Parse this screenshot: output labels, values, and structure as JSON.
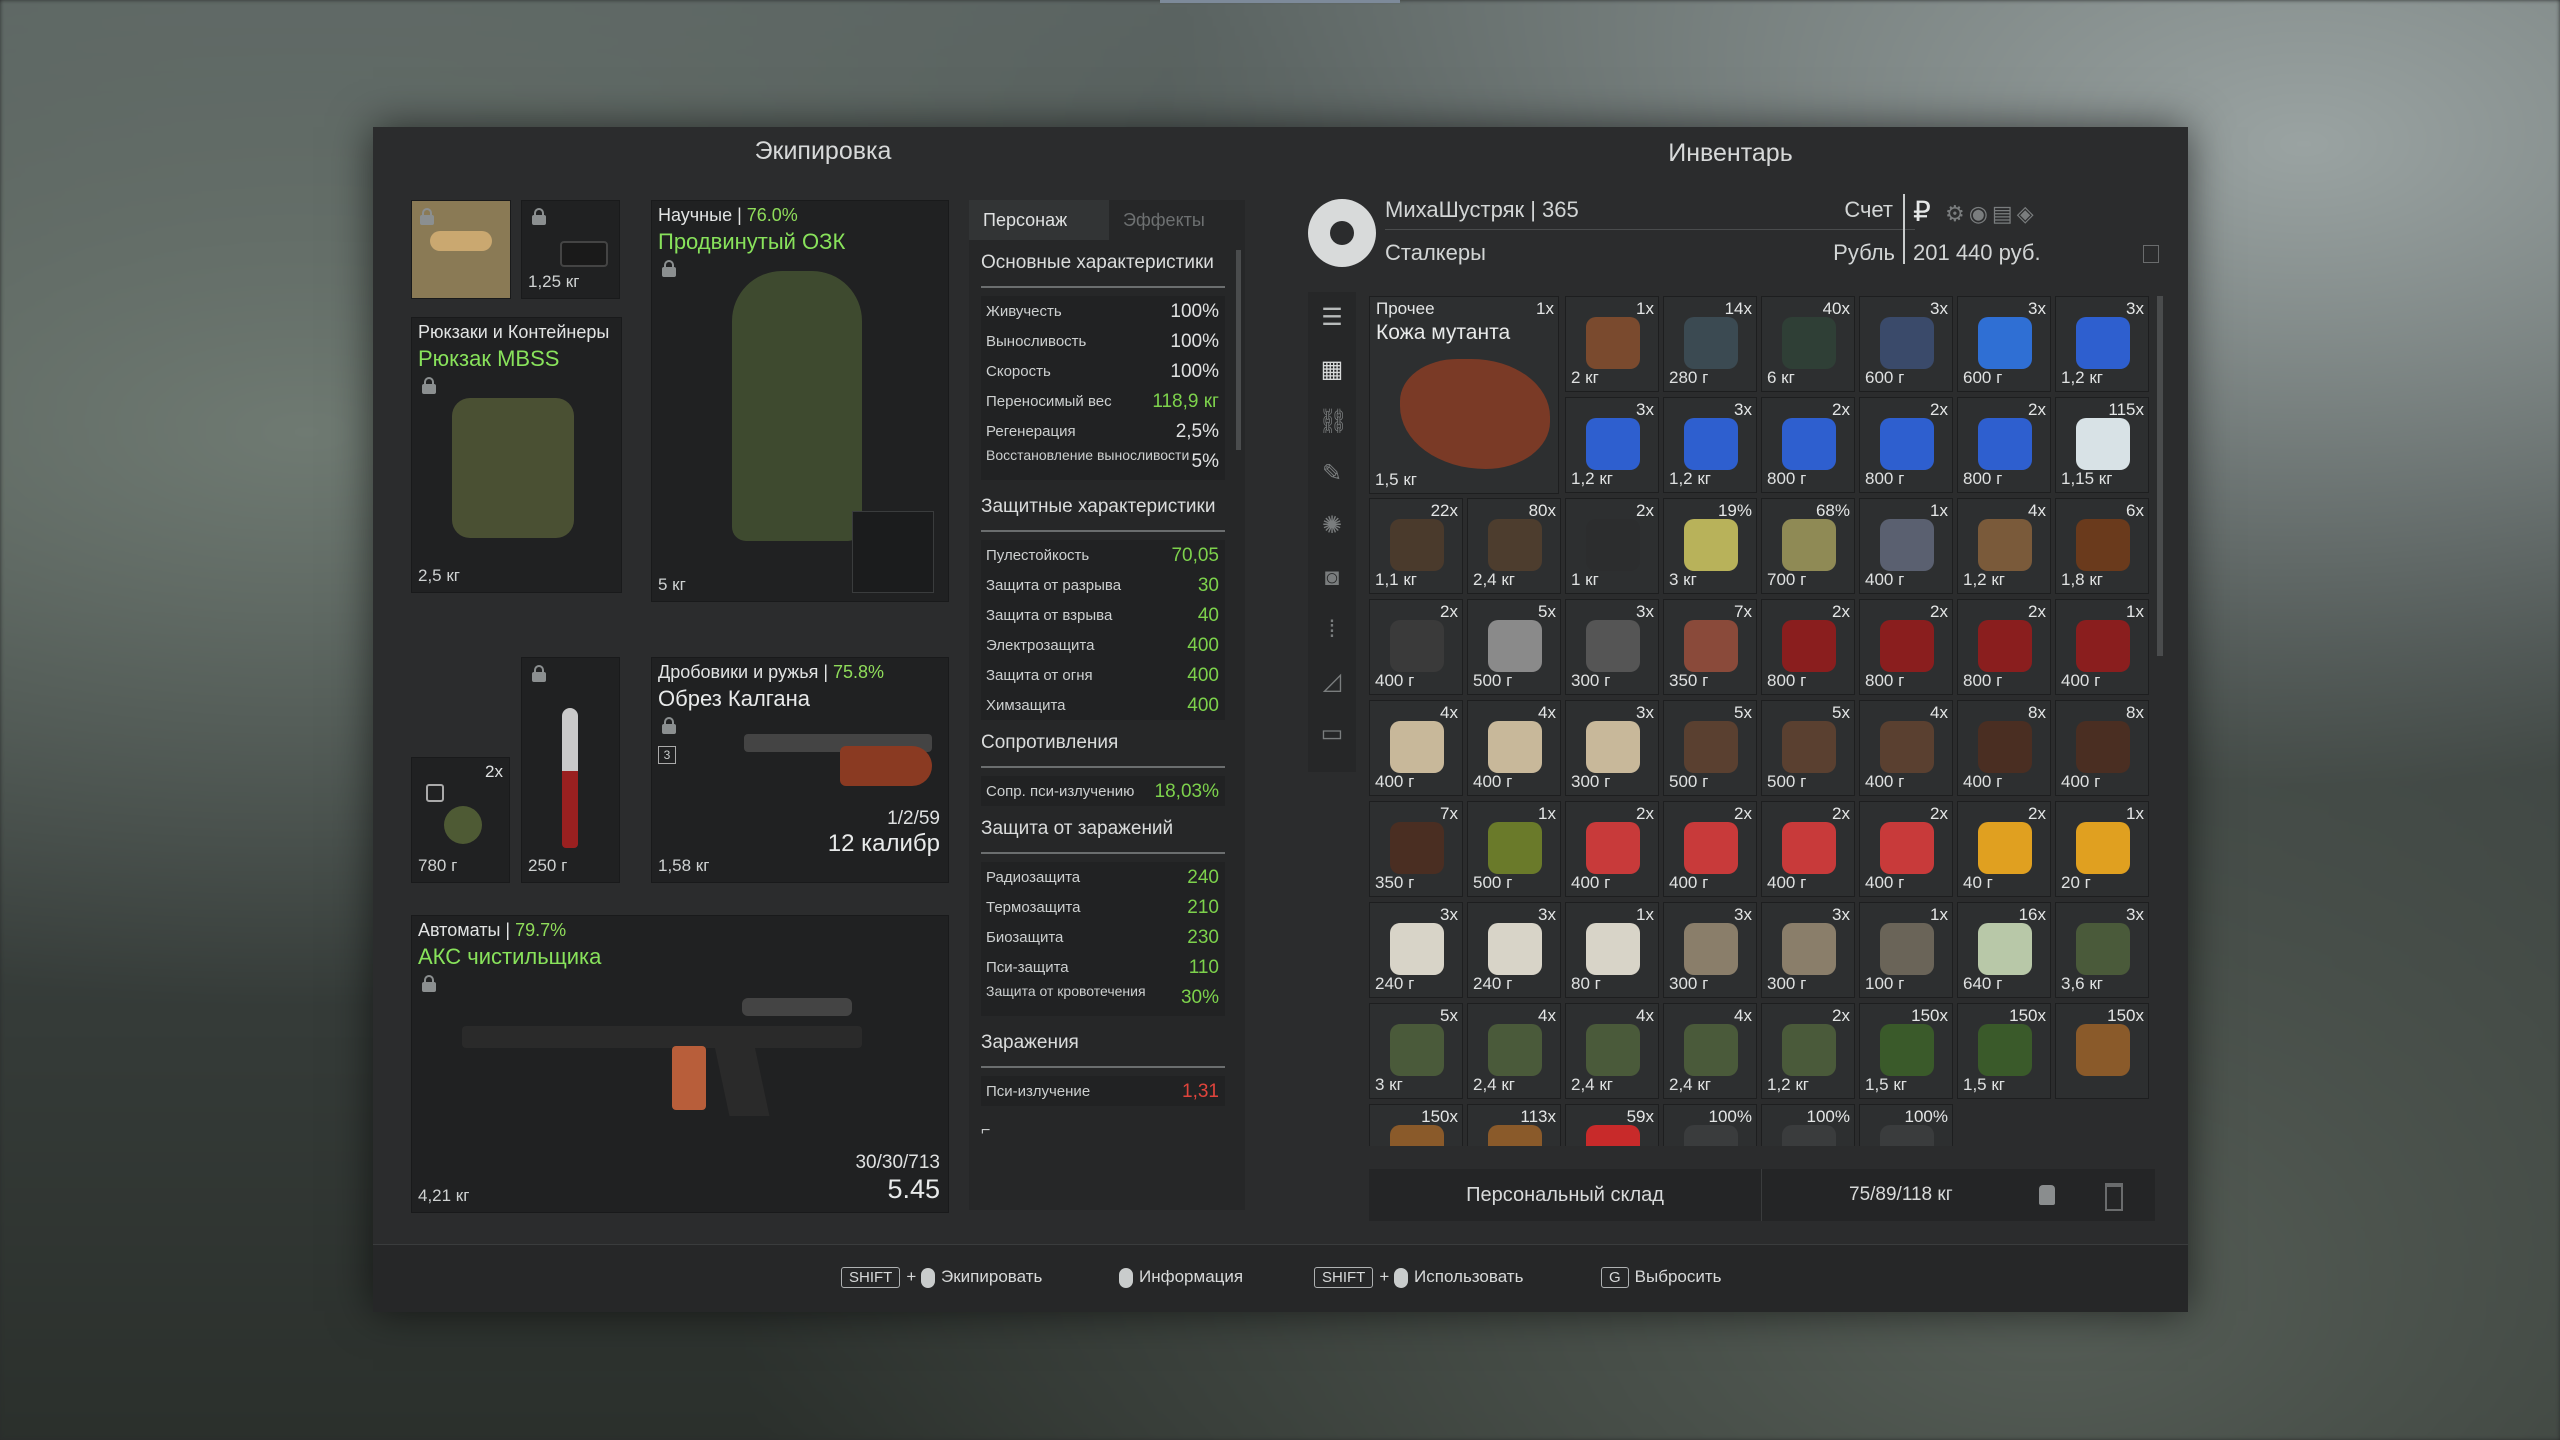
{
  "equipment": {
    "title": "Экипировка",
    "mask_slot": {
      "weight": ""
    },
    "device_slot": {
      "weight": "1,25 кг"
    },
    "backpack": {
      "category": "Рюкзаки и Контейнеры",
      "name": "Рюкзак MBSS",
      "weight": "2,5 кг"
    },
    "suit": {
      "category": "Научные",
      "durability": "76.0%",
      "name": "Продвинутый ОЗК",
      "weight": "5 кг"
    },
    "grenade": {
      "count": "2x",
      "weight": "780 г"
    },
    "knife": {
      "weight": "250 г"
    },
    "shotgun": {
      "category": "Дробовики и ружья",
      "durability": "75.8%",
      "name": "Обрез Калгана",
      "weight": "1,58 кг",
      "ammo": "1/2/59",
      "caliber": "12 калибр",
      "slot_number": "3"
    },
    "rifle": {
      "category": "Автоматы",
      "durability": "79.7%",
      "name": "АКС чистильщика",
      "weight": "4,21 кг",
      "ammo": "30/30/713",
      "caliber": "5.45"
    }
  },
  "stats": {
    "tabs": [
      "Персонаж",
      "Эффекты"
    ],
    "basic_title": "Основные характеристики",
    "basic": [
      {
        "k": "Живучесть",
        "v": "100%"
      },
      {
        "k": "Выносливость",
        "v": "100%"
      },
      {
        "k": "Скорость",
        "v": "100%"
      },
      {
        "k": "Переносимый вес",
        "v": "118,9 кг"
      },
      {
        "k": "Регенерация",
        "v": "2,5%"
      },
      {
        "k": "Восстановление выносливости",
        "v": "5%"
      }
    ],
    "protect_title": "Защитные характеристики",
    "protect": [
      {
        "k": "Пулестойкость",
        "v": "70,05"
      },
      {
        "k": "Защита от разрыва",
        "v": "30"
      },
      {
        "k": "Защита от взрыва",
        "v": "40"
      },
      {
        "k": "Электрозащита",
        "v": "400"
      },
      {
        "k": "Защита от огня",
        "v": "400"
      },
      {
        "k": "Химзащита",
        "v": "400"
      }
    ],
    "resist_title": "Сопротивления",
    "resist": [
      {
        "k": "Сопр. пси-излучению",
        "v": "18,03%"
      }
    ],
    "infect_prot_title": "Защита от заражений",
    "infect_prot": [
      {
        "k": "Радиозащита",
        "v": "240"
      },
      {
        "k": "Термозащита",
        "v": "210"
      },
      {
        "k": "Биозащита",
        "v": "230"
      },
      {
        "k": "Пси-защита",
        "v": "110"
      },
      {
        "k": "Защита от кровотечения",
        "v": "30%"
      }
    ],
    "infect_title": "Заражения",
    "infect": [
      {
        "k": "Пси-излучение",
        "v": "1,31"
      }
    ],
    "footer_mark": "⌐"
  },
  "inventory": {
    "title": "Инвентарь",
    "player": "МихаШустряк | 365",
    "faction": "Сталкеры",
    "account_label": "Счет",
    "currency_label": "Рубль",
    "balance": "201 440 руб.",
    "big_item": {
      "category": "Прочее",
      "name": "Кожа мутанта",
      "count": "1x",
      "weight": "1,5 кг"
    },
    "items": [
      {
        "c": "1x",
        "w": "2 кг",
        "col": "#7a4a2e"
      },
      {
        "c": "14x",
        "w": "280 г",
        "col": "#3b4a52"
      },
      {
        "c": "40x",
        "w": "6 кг",
        "col": "#2f3f36"
      },
      {
        "c": "3x",
        "w": "600 г",
        "col": "#3a4a6a"
      },
      {
        "c": "3x",
        "w": "600 г",
        "col": "#2f6fd4"
      },
      {
        "c": "3x",
        "w": "1,2 кг",
        "col": "#2e5fcf"
      },
      {
        "c": "3x",
        "w": "1,2 кг",
        "col": "#2e5fcf"
      },
      {
        "c": "3x",
        "w": "1,2 кг",
        "col": "#2e5fcf"
      },
      {
        "c": "2x",
        "w": "800 г",
        "col": "#2e5fcf"
      },
      {
        "c": "2x",
        "w": "800 г",
        "col": "#2e5fcf"
      },
      {
        "c": "2x",
        "w": "800 г",
        "col": "#2e5fcf"
      },
      {
        "c": "115x",
        "w": "1,15 кг",
        "col": "#d8e2e6"
      },
      {
        "c": "22x",
        "w": "1,1 кг",
        "col": "#4a3a2c"
      },
      {
        "c": "80x",
        "w": "2,4 кг",
        "col": "#4d3d2e"
      },
      {
        "c": "2x",
        "w": "1 кг",
        "col": "#2c2d2e"
      },
      {
        "c": "19%",
        "w": "3 кг",
        "col": "#b8b25a"
      },
      {
        "c": "68%",
        "w": "700 г",
        "col": "#8f8a55"
      },
      {
        "c": "1x",
        "w": "400 г",
        "col": "#5a6070"
      },
      {
        "c": "4x",
        "w": "1,2 кг",
        "col": "#7a5a3a"
      },
      {
        "c": "6x",
        "w": "1,8 кг",
        "col": "#6a3a1c"
      },
      {
        "c": "2x",
        "w": "400 г",
        "col": "#3a3a3a"
      },
      {
        "c": "5x",
        "w": "500 г",
        "col": "#8a8a8a"
      },
      {
        "c": "3x",
        "w": "300 г",
        "col": "#555"
      },
      {
        "c": "7x",
        "w": "350 г",
        "col": "#8a4a3a"
      },
      {
        "c": "2x",
        "w": "800 г",
        "col": "#8a1e1e"
      },
      {
        "c": "2x",
        "w": "800 г",
        "col": "#8a1e1e"
      },
      {
        "c": "2x",
        "w": "800 г",
        "col": "#8a1e1e"
      },
      {
        "c": "1x",
        "w": "400 г",
        "col": "#8a1e1e"
      },
      {
        "c": "4x",
        "w": "400 г",
        "col": "#c8b89a"
      },
      {
        "c": "4x",
        "w": "400 г",
        "col": "#c8b89a"
      },
      {
        "c": "3x",
        "w": "300 г",
        "col": "#c8b89a"
      },
      {
        "c": "5x",
        "w": "500 г",
        "col": "#5a4030"
      },
      {
        "c": "5x",
        "w": "500 г",
        "col": "#5a4030"
      },
      {
        "c": "4x",
        "w": "400 г",
        "col": "#5a4030"
      },
      {
        "c": "8x",
        "w": "400 г",
        "col": "#4a2e22"
      },
      {
        "c": "8x",
        "w": "400 г",
        "col": "#4a2e22"
      },
      {
        "c": "7x",
        "w": "350 г",
        "col": "#4a2e22"
      },
      {
        "c": "1x",
        "w": "500 г",
        "col": "#6a7a2a"
      },
      {
        "c": "2x",
        "w": "400 г",
        "col": "#c83a3a"
      },
      {
        "c": "2x",
        "w": "400 г",
        "col": "#c83a3a"
      },
      {
        "c": "2x",
        "w": "400 г",
        "col": "#c83a3a"
      },
      {
        "c": "2x",
        "w": "400 г",
        "col": "#c83a3a"
      },
      {
        "c": "2x",
        "w": "40 г",
        "col": "#e0a020"
      },
      {
        "c": "1x",
        "w": "20 г",
        "col": "#e0a020"
      },
      {
        "c": "3x",
        "w": "240 г",
        "col": "#d8d4c8"
      },
      {
        "c": "3x",
        "w": "240 г",
        "col": "#d8d4c8"
      },
      {
        "c": "1x",
        "w": "80 г",
        "col": "#d8d4c8"
      },
      {
        "c": "3x",
        "w": "300 г",
        "col": "#8a7e6a"
      },
      {
        "c": "3x",
        "w": "300 г",
        "col": "#8a7e6a"
      },
      {
        "c": "1x",
        "w": "100 г",
        "col": "#6a6458"
      },
      {
        "c": "16x",
        "w": "640 г",
        "col": "#b8c8a8"
      },
      {
        "c": "3x",
        "w": "3,6 кг",
        "col": "#4a5a3a"
      },
      {
        "c": "5x",
        "w": "3 кг",
        "col": "#4a5a3a"
      },
      {
        "c": "4x",
        "w": "2,4 кг",
        "col": "#4a5a3a"
      },
      {
        "c": "4x",
        "w": "2,4 кг",
        "col": "#4a5a3a"
      },
      {
        "c": "4x",
        "w": "2,4 кг",
        "col": "#4a5a3a"
      },
      {
        "c": "2x",
        "w": "1,2 кг",
        "col": "#4a5a3a"
      },
      {
        "c": "150x",
        "w": "1,5 кг",
        "col": "#3a5a2a"
      },
      {
        "c": "150x",
        "w": "1,5 кг",
        "col": "#3a5a2a"
      },
      {
        "c": "150x",
        "w": "",
        "col": "#8a5a2a"
      },
      {
        "c": "150x",
        "w": "",
        "col": "#8a5a2a"
      },
      {
        "c": "113x",
        "w": "",
        "col": "#8a5a2a"
      },
      {
        "c": "59x",
        "w": "",
        "col": "#c82a2a"
      },
      {
        "c": "100%",
        "w": "",
        "col": "#3a3c3d"
      },
      {
        "c": "100%",
        "w": "",
        "col": "#3a3c3d"
      },
      {
        "c": "100%",
        "w": "",
        "col": "#3a3c3d"
      }
    ],
    "storage_label": "Персональный склад",
    "weight_total": "75/89/118 кг"
  },
  "hints": {
    "shift": "SHIFT",
    "plus": "+",
    "equip": "Экипировать",
    "info": "Информация",
    "use": "Использовать",
    "drop_key": "G",
    "drop": "Выбросить"
  }
}
